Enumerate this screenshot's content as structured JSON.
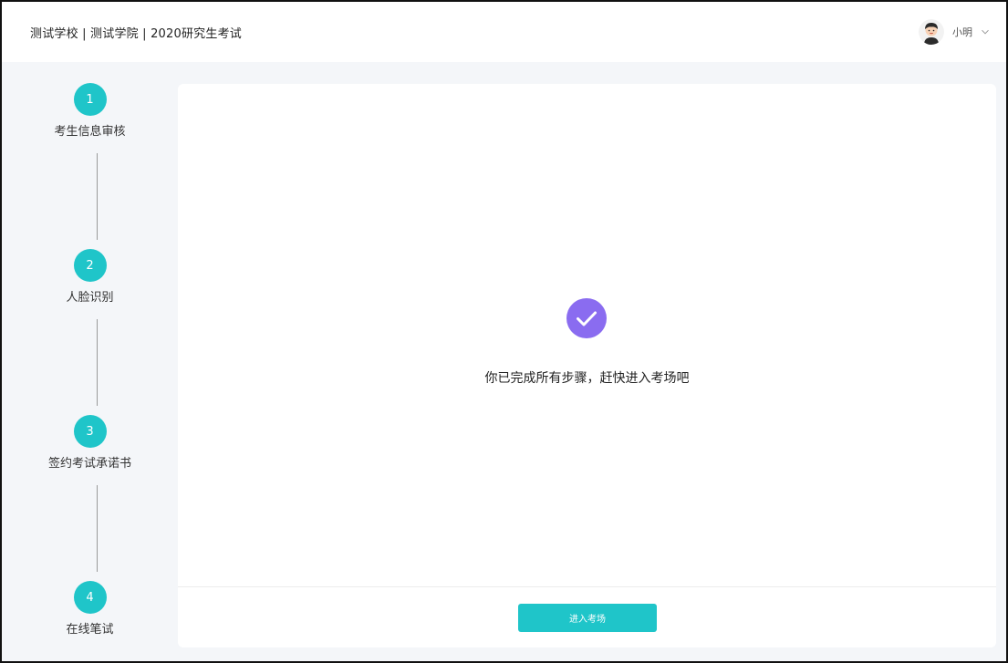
{
  "header": {
    "title": "测试学校 | 测试学院 | 2020研究生考试",
    "user": {
      "name": "小明",
      "avatar_icon": "boy-avatar-icon",
      "menu_icon": "chevron-down-icon"
    }
  },
  "steps": [
    {
      "number": "1",
      "label": "考生信息审核"
    },
    {
      "number": "2",
      "label": "人脸识别"
    },
    {
      "number": "3",
      "label": "签约考试承诺书"
    },
    {
      "number": "4",
      "label": "在线笔试"
    }
  ],
  "main": {
    "status_icon": "check-circle-icon",
    "message": "你已完成所有步骤，赶快进入考场吧",
    "enter_button_label": "进入考场"
  },
  "colors": {
    "accent": "#1fc5c9",
    "success_icon": "#8a6cf0",
    "background": "#f4f6f9",
    "card": "#ffffff"
  }
}
